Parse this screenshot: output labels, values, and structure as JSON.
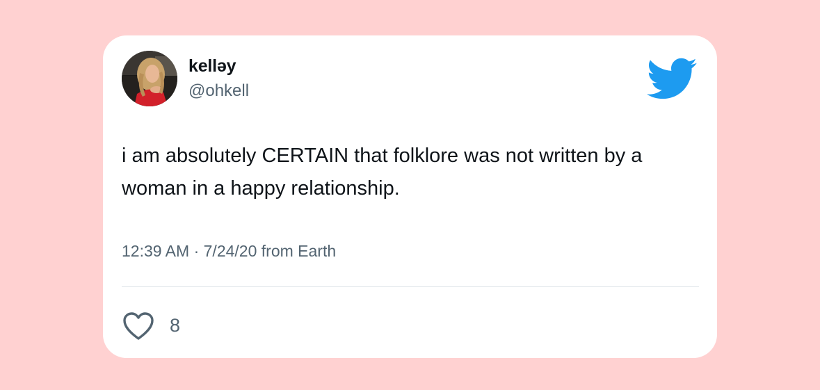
{
  "tweet": {
    "display_name": "kelləy",
    "handle": "@ohkell",
    "text": "i am absolutely CERTAIN that folklore was not written by a woman in a happy relationship.",
    "time": "12:39 AM",
    "separator": "·",
    "date": "7/24/20",
    "source": "from Earth",
    "likes": "8"
  },
  "colors": {
    "background": "#ffd1d1",
    "card": "#ffffff",
    "twitter_blue": "#1d9bf0",
    "text_primary": "#0f1419",
    "text_secondary": "#536471"
  },
  "icons": {
    "brand": "twitter-bird-icon",
    "like": "heart-outline-icon"
  }
}
